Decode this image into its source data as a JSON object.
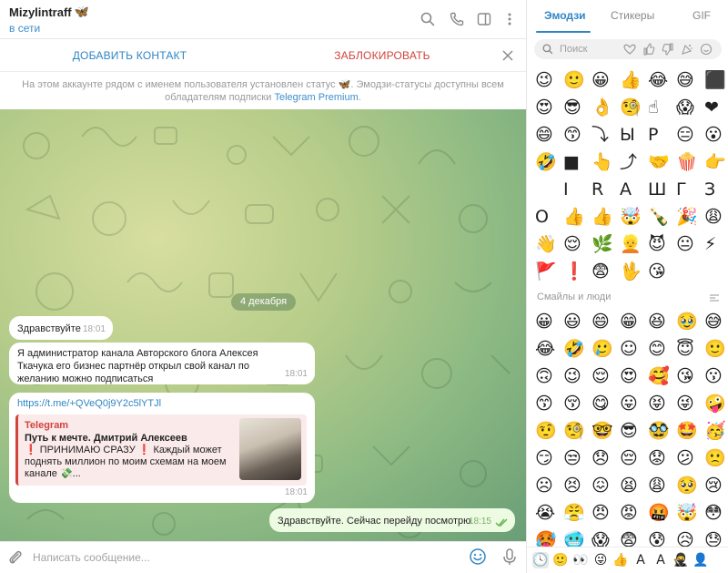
{
  "header": {
    "name": "Mizylintraff",
    "status": "в сети",
    "status_emoji": "🦋"
  },
  "actions": {
    "add_contact": "ДОБАВИТЬ КОНТАКТ",
    "block": "ЗАБЛОКИРОВАТЬ"
  },
  "notice": {
    "line1": "На этом аккаунте рядом с именем пользователя установлен статус",
    "line2": ". Эмодзи-статусы доступны всем",
    "line3": "обладателям подписки",
    "link": "Telegram Premium",
    "tail": "."
  },
  "chat": {
    "date": "4 декабря",
    "messages": [
      {
        "text": "Здравствуйте",
        "time": "18:01"
      },
      {
        "text": "Я администратор канала Авторского блога Алексея Ткачука его бизнес партнёр открыл свой канал по желанию можно подписаться",
        "time": "18:01"
      },
      {
        "url": "https://t.me/+QVeQ0j9Y2c5lYTJl",
        "time": "18:01",
        "preview": {
          "site": "Telegram",
          "title": "Путь к мечте. Дмитрий Алексеев",
          "description": "❗ ПРИНИМАЮ СРАЗУ ❗ Каждый может поднять миллион по моим схемам на моем канале 💸..."
        }
      },
      {
        "text": "Здравствуйте. Сейчас перейду посмотрю",
        "time": "18:15"
      }
    ]
  },
  "composer": {
    "placeholder": "Написать сообщение..."
  },
  "panel": {
    "tabs": [
      "Эмодзи",
      "Стикеры",
      "GIF"
    ],
    "active_tab": "Эмодзи",
    "search_placeholder": "Поиск",
    "section_title": "Смайлы и люди",
    "recent_emojis": [
      "😉",
      "🙂",
      "😀",
      "👍",
      "😂",
      "😅",
      "⬛",
      "😍",
      "😎",
      "👌",
      "🧐",
      "☝",
      "😱",
      "❤",
      "😄",
      "😙",
      "⤵",
      "Ы",
      "Р",
      "😑",
      "😮",
      "🤣",
      "■",
      "👆",
      "⤴",
      "🤝",
      "🍿",
      "👉",
      "",
      "І",
      "R",
      "А",
      "Ш",
      "Г",
      "З",
      "О",
      "👍",
      "👍",
      "🤯",
      "🍾",
      "🎉",
      "😩",
      "👋",
      "😌",
      "🌿",
      "👱",
      "😈",
      "😐",
      "⚡",
      "🚩",
      "❗",
      "😨",
      "🖖",
      "😘",
      "",
      ""
    ],
    "smiley_emojis": [
      "😀",
      "😃",
      "😄",
      "😁",
      "😆",
      "🥹",
      "😅",
      "😂",
      "🤣",
      "🥲",
      "☺",
      "😊",
      "😇",
      "🙂",
      "🙃",
      "😉",
      "😌",
      "😍",
      "🥰",
      "😘",
      "😗",
      "😙",
      "😚",
      "😋",
      "😛",
      "😝",
      "😜",
      "🤪",
      "🤨",
      "🧐",
      "🤓",
      "😎",
      "🥸",
      "🤩",
      "🥳",
      "😏",
      "😒",
      "😞",
      "😔",
      "😟",
      "😕",
      "🙁",
      "☹",
      "😣",
      "😖",
      "😫",
      "😩",
      "🥺",
      "😢",
      "😭",
      "😤",
      "😠",
      "😡",
      "🤬",
      "🤯",
      "😳",
      "🥵",
      "🥶",
      "😱",
      "😨",
      "😰",
      "😥",
      "😓"
    ],
    "footer": [
      "🕓",
      "🙂",
      "👀",
      "😜",
      "👍",
      "A",
      "A",
      "🥷",
      "👤"
    ]
  },
  "colors": {
    "accent": "#2f86c4",
    "danger": "#d2433c",
    "outgoing": "#eefbe3"
  }
}
